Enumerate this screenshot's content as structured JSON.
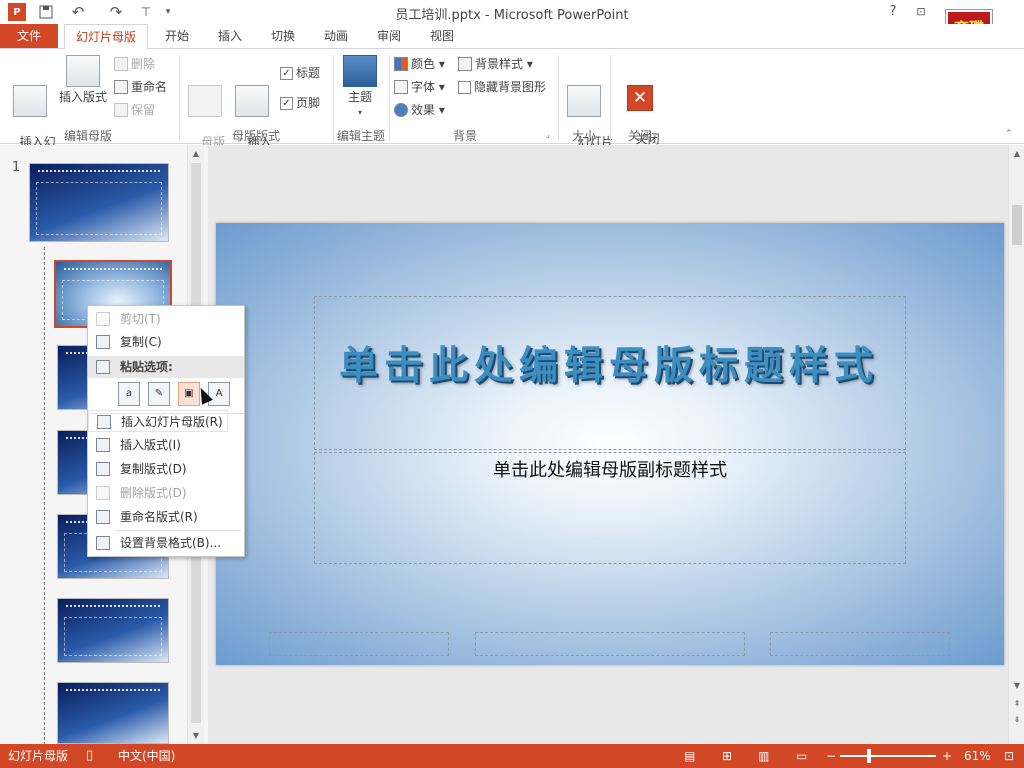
{
  "window": {
    "title": "员工培训.pptx - Microsoft PowerPoint",
    "help": "?",
    "logo_line1": "育碟",
    "logo_line2": "软件"
  },
  "tabs": [
    "文件",
    "幻灯片母版",
    "开始",
    "插入",
    "切换",
    "动画",
    "审阅",
    "视图"
  ],
  "ribbon": {
    "insert_master": "插入幻\n灯片母版",
    "insert_layout": "插入版式",
    "delete": "删除",
    "rename": "重命名",
    "preserve": "保留",
    "master_layout": "母版\n版式",
    "insert_placeholder": "插入\n占位符 ▾",
    "title_check": "标题",
    "footer_check": "页脚",
    "themes": "主题",
    "colors": "颜色 ▾",
    "fonts": "字体 ▾",
    "effects": "效果 ▾",
    "bg_styles": "背景样式 ▾",
    "hide_bg": "隐藏背景图形",
    "slide_size": "幻灯片\n大小 ▾",
    "close_master": "关闭\n母版视图",
    "groups": [
      "编辑母版",
      "母版版式",
      "编辑主题",
      "背景",
      "大小",
      "关闭"
    ]
  },
  "slides_panel": {
    "first_number": "1"
  },
  "context_menu": {
    "cut": "剪切(T)",
    "copy": "复制(C)",
    "paste_options": "粘贴选项:",
    "insert_master": "插入幻灯片母版(R)",
    "insert_layout": "插入版式(I)",
    "duplicate_layout": "复制版式(D)",
    "delete_layout": "删除版式(D)",
    "rename_layout": "重命名版式(R)",
    "format_background": "设置背景格式(B)..."
  },
  "slide": {
    "title": "单击此处编辑母版标题样式",
    "subtitle": "单击此处编辑母版副标题样式"
  },
  "status": {
    "view_name": "幻灯片母版",
    "language": "中文(中国)",
    "zoom": "61%"
  },
  "colors": {
    "accent": "#d24726",
    "file_tab": "#d24726"
  }
}
